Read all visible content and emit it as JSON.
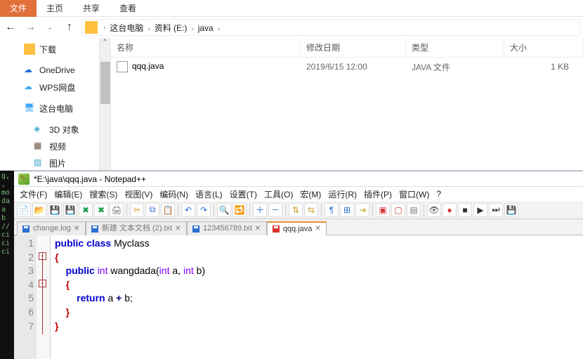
{
  "explorer": {
    "tabs": [
      "文件",
      "主页",
      "共享",
      "查看"
    ],
    "active_tab": 0,
    "breadcrumbs": [
      "这台电脑",
      "资料 (E:)",
      "java"
    ],
    "sidebar": [
      {
        "label": "下载",
        "icon": "folder",
        "color": "#ffbf3f"
      },
      {
        "label": "OneDrive",
        "icon": "cloud",
        "color": "#1e6fd6"
      },
      {
        "label": "WPS网盘",
        "icon": "cloud",
        "color": "#3da8f5"
      },
      {
        "label": "这台电脑",
        "icon": "pc",
        "color": "#3da8f5"
      },
      {
        "label": "3D 对象",
        "icon": "cube",
        "color": "#3aa7c9",
        "indent": true
      },
      {
        "label": "视频",
        "icon": "video",
        "color": "#6e4f3a",
        "indent": true
      },
      {
        "label": "图片",
        "icon": "image",
        "color": "#3aa7c9",
        "indent": true
      }
    ],
    "columns": {
      "name": "名称",
      "date": "修改日期",
      "type": "类型",
      "size": "大小"
    },
    "files": [
      {
        "name": "qqq.java",
        "date": "2019/6/15 12:00",
        "type": "JAVA 文件",
        "size": "1 KB"
      }
    ]
  },
  "npp": {
    "title": "*E:\\java\\qqq.java - Notepad++",
    "menu": [
      "文件(F)",
      "编辑(E)",
      "搜索(S)",
      "视图(V)",
      "编码(N)",
      "语言(L)",
      "设置(T)",
      "工具(O)",
      "宏(M)",
      "运行(R)",
      "插件(P)",
      "窗口(W)",
      "?"
    ],
    "toolbar_icons": [
      {
        "name": "new-file-icon",
        "glyph": "📄",
        "color": "#7fbf3f"
      },
      {
        "name": "open-file-icon",
        "glyph": "📂",
        "color": "#c9a227"
      },
      {
        "name": "save-icon",
        "glyph": "💾",
        "color": "#2a6fd6"
      },
      {
        "name": "save-all-icon",
        "glyph": "💾",
        "color": "#2a6fd6"
      },
      {
        "name": "close-icon",
        "glyph": "✖",
        "color": "#1a9e4b"
      },
      {
        "name": "close-all-icon",
        "glyph": "✖",
        "color": "#1a9e4b"
      },
      {
        "name": "print-icon",
        "glyph": "🖨",
        "color": "#777"
      },
      {
        "name": "sep"
      },
      {
        "name": "cut-icon",
        "glyph": "✂",
        "color": "#c9a227"
      },
      {
        "name": "copy-icon",
        "glyph": "⧉",
        "color": "#2a6fd6"
      },
      {
        "name": "paste-icon",
        "glyph": "📋",
        "color": "#c9a227"
      },
      {
        "name": "sep"
      },
      {
        "name": "undo-icon",
        "glyph": "↶",
        "color": "#2a6fd6"
      },
      {
        "name": "redo-icon",
        "glyph": "↷",
        "color": "#2a6fd6"
      },
      {
        "name": "sep"
      },
      {
        "name": "find-icon",
        "glyph": "🔍",
        "color": "#6a6"
      },
      {
        "name": "replace-icon",
        "glyph": "🔁",
        "color": "#6a6"
      },
      {
        "name": "sep"
      },
      {
        "name": "zoom-in-icon",
        "glyph": "＋",
        "color": "#2a6fd6"
      },
      {
        "name": "zoom-out-icon",
        "glyph": "－",
        "color": "#2a6fd6"
      },
      {
        "name": "sep"
      },
      {
        "name": "sync-v-icon",
        "glyph": "⇅",
        "color": "#c9a227"
      },
      {
        "name": "sync-h-icon",
        "glyph": "⇆",
        "color": "#c9a227"
      },
      {
        "name": "sep"
      },
      {
        "name": "wordwrap-icon",
        "glyph": "¶",
        "color": "#2a6fd6"
      },
      {
        "name": "allchars-icon",
        "glyph": "⊞",
        "color": "#2a6fd6"
      },
      {
        "name": "indent-icon",
        "glyph": "⇥",
        "color": "#c9a227"
      },
      {
        "name": "sep"
      },
      {
        "name": "fold-icon",
        "glyph": "▣",
        "color": "#d33"
      },
      {
        "name": "unfold-icon",
        "glyph": "▢",
        "color": "#d33"
      },
      {
        "name": "hide-lines-icon",
        "glyph": "▤",
        "color": "#777"
      },
      {
        "name": "sep"
      },
      {
        "name": "monitor-icon",
        "glyph": "👁",
        "color": "#555"
      },
      {
        "name": "record-icon",
        "glyph": "●",
        "color": "#d33"
      },
      {
        "name": "stop-icon",
        "glyph": "■",
        "color": "#333"
      },
      {
        "name": "play-icon",
        "glyph": "▶",
        "color": "#333"
      },
      {
        "name": "repeat-icon",
        "glyph": "⏭",
        "color": "#333"
      },
      {
        "name": "save-macro-icon",
        "glyph": "💾",
        "color": "#777"
      }
    ],
    "tabs": [
      {
        "label": "change.log",
        "active": false,
        "unsaved": false
      },
      {
        "label": "新建 文本文档 (2).txt",
        "active": false,
        "unsaved": false
      },
      {
        "label": "123456789.txt",
        "active": false,
        "unsaved": false
      },
      {
        "label": "qqq.java",
        "active": true,
        "unsaved": true
      }
    ],
    "code": [
      {
        "n": 1,
        "html": "<span class='kw'>public</span> <span class='kw'>class</span> <span class='id'>Myclass</span>"
      },
      {
        "n": 2,
        "html": "<span class='br'>{</span>"
      },
      {
        "n": 3,
        "html": "    <span class='kw'>public</span> <span class='kw2'>int</span> <span class='id'>wangdada</span>(<span class='kw2'>int</span> a, <span class='kw2'>int</span> b)"
      },
      {
        "n": 4,
        "html": "    <span class='br'>{</span>"
      },
      {
        "n": 5,
        "html": "        <span class='kw'>return</span> a <span class='op'>+</span> b;"
      },
      {
        "n": 6,
        "html": "    <span class='br'>}</span>"
      },
      {
        "n": 7,
        "html": "<span class='br'>}</span> "
      }
    ],
    "cursor_line": 7
  }
}
